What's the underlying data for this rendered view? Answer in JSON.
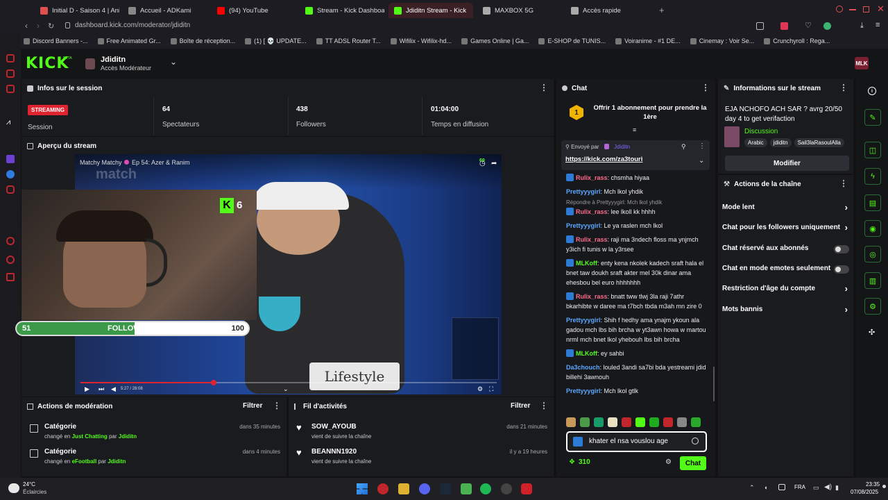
{
  "browser": {
    "tabs": [
      {
        "label": "Initial D - Saison 4 | Anim",
        "color": "#e05050"
      },
      {
        "label": "Accueil - ADKami",
        "color": "#888888"
      },
      {
        "label": "(94) YouTube",
        "color": "#ff0000"
      },
      {
        "label": "Stream - Kick Dashboard",
        "color": "#53fc18"
      },
      {
        "label": "Jdiditn Stream - Kick",
        "color": "#53fc18"
      },
      {
        "label": "MAXBOX 5G",
        "color": "#aaaaaa"
      },
      {
        "label": "Accès rapide",
        "color": "#aaaaaa"
      }
    ],
    "url": "dashboard.kick.com/moderator/jdiditn",
    "bookmarks": [
      "Discord Banners -...",
      "Free Animated Gr...",
      "Boîte de réception...",
      "(1) [ 💀 UPDATE...",
      "TT ADSL Router T...",
      "Wifilix - Wifilix-hd...",
      "Games Online | Ga...",
      "E-SHOP de TUNIS...",
      "Voiranime - #1 DE...",
      "Cinemay : Voir Se...",
      "Crunchyroll : Rega..."
    ]
  },
  "kick": {
    "logo": "KICK",
    "logo_sup": "BETA",
    "channel_name": "Jdiditn",
    "channel_role": "Accès Modérateur",
    "avatar_text": "MLK"
  },
  "session": {
    "title": "Infos sur le session",
    "status_badge": "STREAMING",
    "status_label": "Session",
    "stats": [
      {
        "value": "64",
        "label": "Spectateurs"
      },
      {
        "value": "438",
        "label": "Followers"
      },
      {
        "value": "01:04:00",
        "label": "Temps en diffusion"
      }
    ]
  },
  "preview": {
    "title": "Aperçu du stream",
    "video_title": "Matchy Matchy",
    "video_episode": "Ep 54: Azer & Ranim",
    "watermark": "match",
    "kick_count": "6",
    "kick_small_count": "69",
    "followers_left": "51",
    "followers_label": "FOLLOWERS",
    "followers_right": "100",
    "followers_progress": 0.51,
    "sign_text": "Lifestyle",
    "time_display": "5:27 / 28:08",
    "seek_progress": 0.32
  },
  "moderation": {
    "title": "Actions de modération",
    "filter": "Filtrer",
    "items": [
      {
        "title": "Catégorie",
        "prefix": "changé en",
        "value": "Just Chatting",
        "by": "par",
        "user": "Jdiditn",
        "time": "dans 35 minutes"
      },
      {
        "title": "Catégorie",
        "prefix": "changé en",
        "value": "eFootball",
        "by": "par",
        "user": "Jdiditn",
        "time": "dans 4 minutes"
      }
    ]
  },
  "activity": {
    "title": "Fil d'activités",
    "filter": "Filtrer",
    "items": [
      {
        "user": "SOW_AYOUB",
        "action": "vient de suivre la chaîne",
        "time": "dans 21 minutes"
      },
      {
        "user": "BEANNN1920",
        "action": "vient de suivre la chaîne",
        "time": "il y a 19 heures"
      }
    ]
  },
  "chat": {
    "title": "Chat",
    "gift_text": "Offrir 1 abonnement pour prendre la 1ère",
    "gift_rank": "1",
    "pinned_by": "Envoyé par",
    "pinned_user": "Jdiditn",
    "pinned_link": "https://kick.com/za3touri",
    "reply_note": "Répondre à Prettyyygirl: Mch lkol yhdik",
    "messages": [
      {
        "user": "Rulix_rass",
        "color": "#ff6b8a",
        "badge": true,
        "text": ": chsmha hiyaa"
      },
      {
        "user": "Prettyyygirl",
        "color": "#5aa8ff",
        "badge": false,
        "text": ": Mch lkol yhdik"
      },
      {
        "user": "Rulix_rass",
        "color": "#ff6b8a",
        "badge": true,
        "text": ": lee lkoll kk hhhh"
      },
      {
        "user": "Prettyyygirl",
        "color": "#5aa8ff",
        "badge": false,
        "text": ": Le ya raslen mch lkol"
      },
      {
        "user": "Rulix_rass",
        "color": "#ff6b8a",
        "badge": true,
        "text": ": raji ma 3ndech floss ma ynjmch y3ich fi tunis w la y3rsee"
      },
      {
        "user": "MLKoff",
        "color": "#53fc18",
        "badge": true,
        "text": ": enty kena nkolek kadech sraft hala el bnet taw doukh sraft akter mel 30k dinar ama ehesbou bel euro hhhhhhh"
      },
      {
        "user": "Rulix_rass",
        "color": "#ff6b8a",
        "badge": true,
        "text": ": bnatt tww tlwj 3la raji 7athr bkarhibte w daree ma t7bch tbda m3ah mn zire 0"
      },
      {
        "user": "Prettyyygirl",
        "color": "#5aa8ff",
        "badge": false,
        "text": ": Shih f hedhy ama ynajm ykoun ala gadou mch lbs bih brcha w yt3awn howa w martou nrml mch bnet lkol yhebouh lbs bih brcha"
      },
      {
        "user": "MLKoff",
        "color": "#53fc18",
        "badge": true,
        "text": ": ey sahbi"
      },
      {
        "user": "Da3chouch",
        "color": "#5aa8ff",
        "badge": false,
        "text": ": louled 3andi sa7bi bda yestreami jdid billehi 3awnouh"
      },
      {
        "user": "Prettyyygirl",
        "color": "#5aa8ff",
        "badge": false,
        "text": ": Mch lkol gtlk"
      }
    ],
    "input_value": "khater el nsa vouslou age",
    "points": "310",
    "send_button": "Chat"
  },
  "stream_info": {
    "title": "Informations sur le stream",
    "stream_title": "EJA NCHOFO ACH SAR ? avrg 20/50 day 4 to get verifaction",
    "category": "Discussion",
    "tags": [
      "Arabic",
      "jdiditn",
      "Sail3laRasoulAlla"
    ],
    "edit_button": "Modifier"
  },
  "channel_actions": {
    "title": "Actions de la chaîne",
    "items": [
      {
        "label": "Mode lent",
        "kind": "arrow"
      },
      {
        "label": "Chat pour les followers uniquement",
        "kind": "arrow"
      },
      {
        "label": "Chat réservé aux abonnés",
        "kind": "toggle"
      },
      {
        "label": "Chat en mode emotes seulement",
        "kind": "toggle"
      },
      {
        "label": "Restriction d'âge du compte",
        "kind": "arrow"
      },
      {
        "label": "Mots bannis",
        "kind": "arrow"
      }
    ]
  },
  "taskbar": {
    "weather_temp": "24°C",
    "weather_desc": "Éclaircies",
    "lang": "FRA",
    "time": "23:35",
    "date": "07/08/2025"
  },
  "colors": {
    "kick_green": "#53fc18",
    "streaming_red": "#e0242f",
    "panel_bg": "#191b1f"
  }
}
